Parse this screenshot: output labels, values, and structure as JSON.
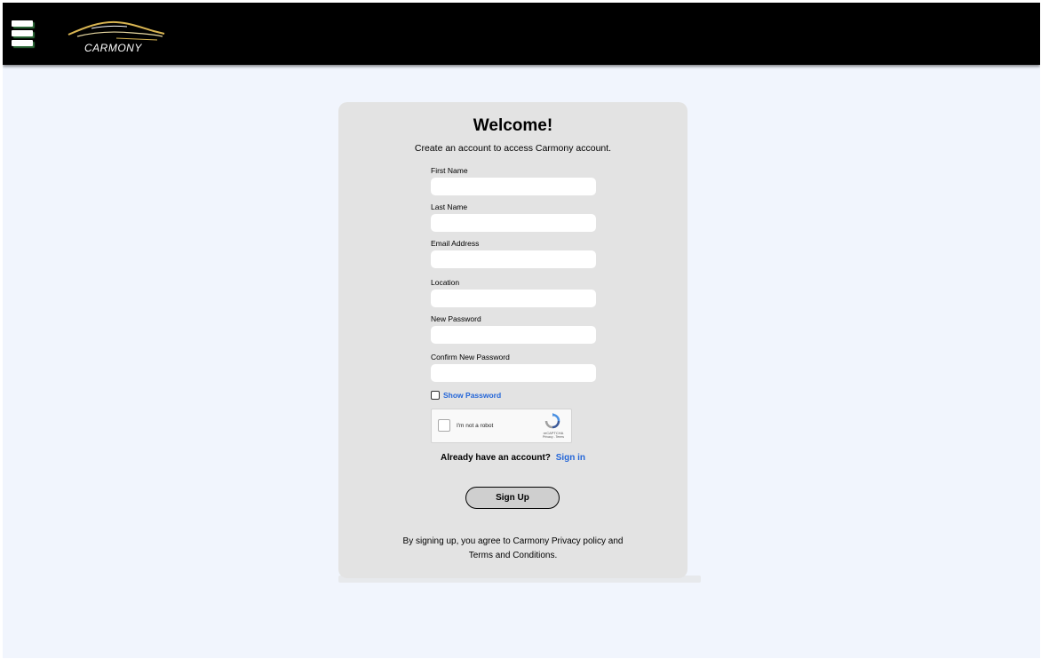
{
  "header": {
    "logo_text": "CARMONY",
    "menu_icon": "hamburger-menu-icon"
  },
  "form": {
    "title": "Welcome!",
    "subtitle": "Create an account to access Carmony account.",
    "fields": [
      {
        "label": "First Name",
        "value": "",
        "placeholder": ""
      },
      {
        "label": "Last Name",
        "value": "",
        "placeholder": ""
      },
      {
        "label": "Email Address",
        "value": "",
        "placeholder": ""
      },
      {
        "label": "Location",
        "value": "",
        "placeholder": ""
      },
      {
        "label": "New Password",
        "value": "",
        "placeholder": ""
      },
      {
        "label": "Confirm New Password",
        "value": "",
        "placeholder": ""
      }
    ],
    "show_password_label": "Show Password",
    "show_password_checked": false,
    "captcha": {
      "label": "I'm not a robot",
      "brand": "reCAPTCHA",
      "terms": "Privacy - Terms",
      "checked": false
    },
    "signin_prompt": "Already have an account?",
    "signin_link": "Sign in",
    "signup_button": "Sign Up",
    "terms_line1": "By signing up, you agree to Carmony Privacy policy and",
    "terms_line2": "Terms and Conditions."
  },
  "colors": {
    "header_bg": "#000000",
    "page_bg": "#f1f5fd",
    "card_bg": "#e3e3e3",
    "link": "#2466d8",
    "logo_accent": "#d9b552"
  }
}
